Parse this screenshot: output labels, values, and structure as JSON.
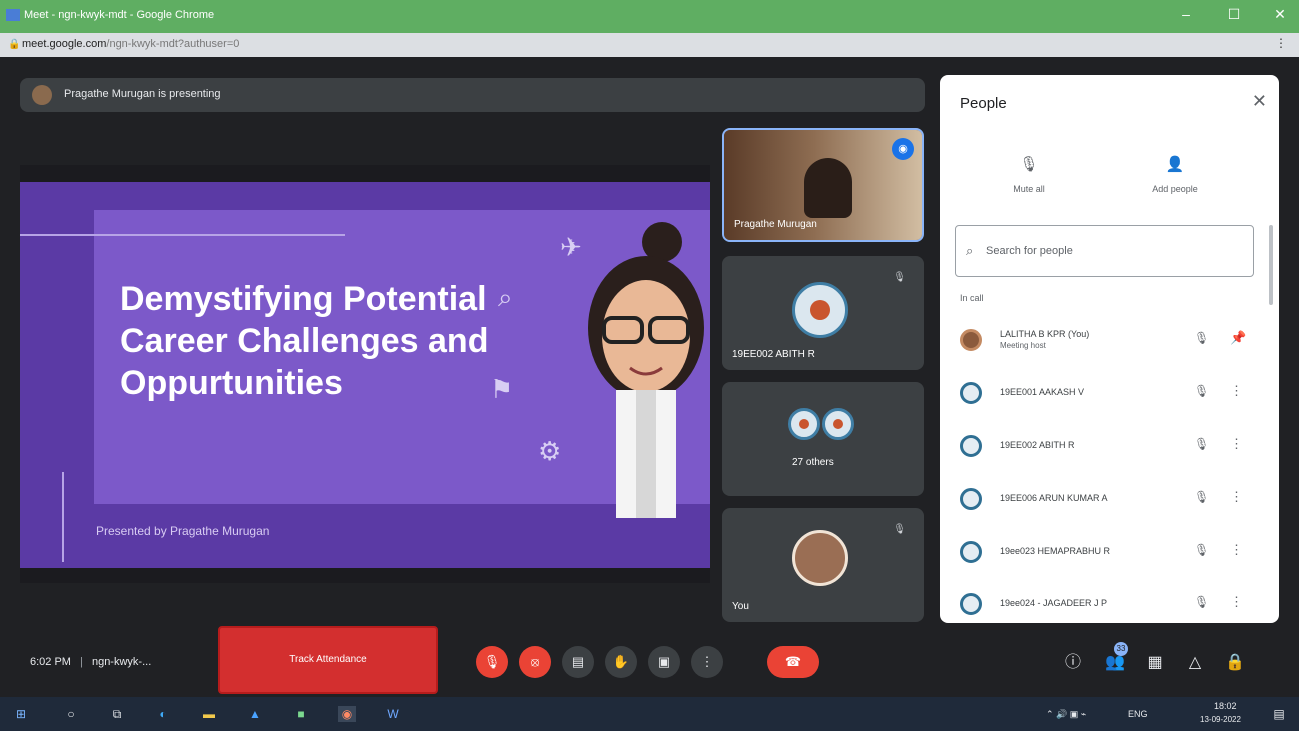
{
  "window": {
    "title": "Meet - ngn-kwyk-mdt - Google Chrome",
    "controls": {
      "minimize": "–",
      "maximize": "☐",
      "close": "✕"
    }
  },
  "address": {
    "host": "meet.google.com",
    "path": "/ngn-kwyk-mdt?authuser=0"
  },
  "presenting_bar": {
    "text": "Pragathe Murugan is presenting"
  },
  "slide": {
    "title": "Demystifying Potential Career Challenges and Oppurtunities",
    "byline": "Presented by Pragathe Murugan"
  },
  "tiles": [
    {
      "name": "Pragathe Murugan"
    },
    {
      "name": "19EE002 ABITH R"
    },
    {
      "name": "27 others"
    },
    {
      "name": "You"
    }
  ],
  "bottom_bar": {
    "time": "6:02 PM",
    "meeting_code": "ngn-kwyk-...",
    "track_attendance": "Track Attendance",
    "participant_count": "33"
  },
  "people_panel": {
    "title": "People",
    "mute_all": "Mute all",
    "add_people": "Add people",
    "search_placeholder": "Search for people",
    "in_call_label": "In call",
    "participants": [
      {
        "name": "LALITHA B KPR (You)",
        "role": "Meeting host"
      },
      {
        "name": "19EE001 AAKASH V",
        "role": ""
      },
      {
        "name": "19EE002 ABITH R",
        "role": ""
      },
      {
        "name": "19EE006 ARUN KUMAR A",
        "role": ""
      },
      {
        "name": "19ee023 HEMAPRABHU R",
        "role": ""
      },
      {
        "name": "19ee024 - JAGADEER J P",
        "role": ""
      }
    ]
  },
  "tray": {
    "lang": "ENG",
    "time": "18:02",
    "date": "13-09-2022"
  },
  "colors": {
    "accent": "#1a73e8",
    "danger": "#ea4335",
    "slide_bg": "#5b3aa5",
    "panel": "#ffffff"
  }
}
